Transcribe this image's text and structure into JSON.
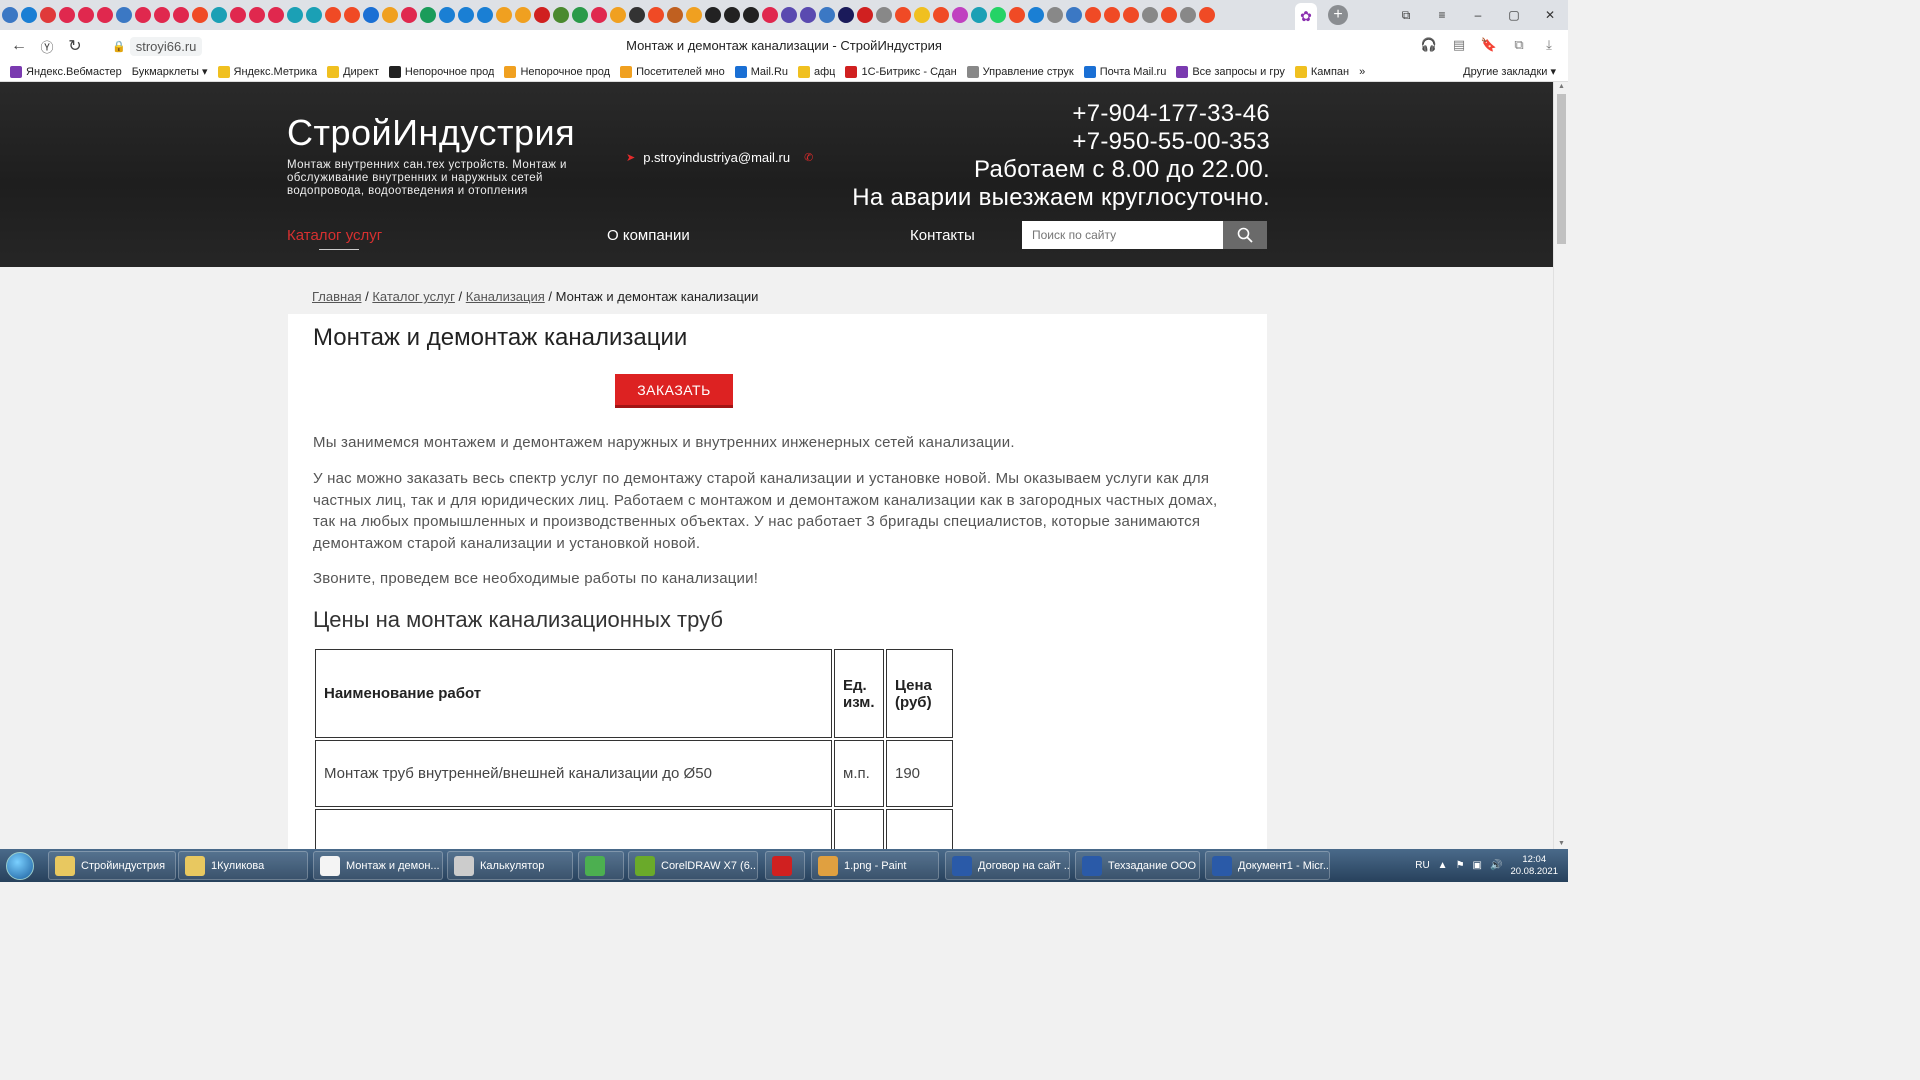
{
  "browser": {
    "title": "Монтаж и демонтаж канализации - СтройИндустрия",
    "url": "stroyi66.ru",
    "bookmarks": [
      "Яндекс.Вебмастер",
      "Букмарклеты ▾",
      "Яндекс.Метрика",
      "Директ",
      "Непорочное прод",
      "Непорочное прод",
      "Посетителей мно",
      "Mail.Ru",
      "афц",
      "1С-Битрикс - Сдан",
      "Управление струк",
      "Почта Mail.ru",
      "Все запросы и гру",
      "Кампан",
      "»",
      "Другие закладки ▾"
    ],
    "tab_icon_colors": [
      "#3b78c4",
      "#1a7fd4",
      "#e03a3a",
      "#e0284e",
      "#e0284e",
      "#e0284e",
      "#3b78c4",
      "#e0284e",
      "#e0284e",
      "#e0284e",
      "#f04a25",
      "#1ba0b5",
      "#e0284e",
      "#e0284e",
      "#e0284e",
      "#1ba0b5",
      "#1ba0b5",
      "#f04a25",
      "#f04a25",
      "#1a6fd4",
      "#f0a020",
      "#e0284e",
      "#1a9c5a",
      "#1a7fd4",
      "#1a7fd4",
      "#1a7fd4",
      "#f0a020",
      "#f0a020",
      "#d02020",
      "#4a8a30",
      "#2a9a4a",
      "#e0284e",
      "#f0a020",
      "#333333",
      "#f04a25",
      "#c06020",
      "#f0a020",
      "#222222",
      "#222222",
      "#222222",
      "#e0284e",
      "#5a4ab0",
      "#5a4ab0",
      "#3b78c4",
      "#1a1a5a",
      "#d02020",
      "#888888",
      "#f04a25",
      "#f0c020",
      "#f04a25",
      "#c040c0",
      "#1ba0b5",
      "#25d366",
      "#f04a25",
      "#1a7fd4",
      "#888888",
      "#3b78c4",
      "#f04a25",
      "#f04a25",
      "#f04a25",
      "#888888",
      "#f04a25",
      "#888888",
      "#f04a25"
    ],
    "window_controls": [
      "⧉",
      "≡",
      "–",
      "▢",
      "✕"
    ]
  },
  "site": {
    "logo": "СтройИндустрия",
    "tagline": "Монтаж внутренних сан.тех устройств. Монтаж и обслуживание внутренних и наружных сетей водопровода, водоотведения и отопления",
    "email": "p.stroyindustriya@mail.ru",
    "phones": [
      "+7-904-177-33-46",
      "+7-950-55-00-353"
    ],
    "hours": "Работаем с 8.00 до 22.00.",
    "emergency": "На аварии выезжаем круглосуточно.",
    "nav": {
      "catalog": "Каталог услуг",
      "about": "О компании",
      "contacts": "Контакты"
    },
    "search_placeholder": "Поиск по сайту",
    "accent_color": "#dd2222"
  },
  "breadcrumb": {
    "home": "Главная",
    "catalog": "Каталог услуг",
    "category": "Канализация",
    "current": "Монтаж и демонтаж канализации"
  },
  "page": {
    "title": "Монтаж и демонтаж канализации",
    "order_button": "ЗАКАЗАТЬ",
    "p1": "Мы занимемся монтажем и демонтажем наружных и внутренних инженерных сетей канализации.",
    "p2": "У нас можно заказать весь спектр услуг по демонтажу старой канализации и установке новой. Мы оказываем услуги как для частных лиц, так и для юридических лиц. Работаем с монтажом и демонтажом канализации как в загородных частных домах, так на любых промышленных и производственных объектах. У нас работает 3 бригады специалистов, которые занимаются демонтажом старой канализации и установкой новой.",
    "p3": "Звоните, проведем все необходимые работы по канализации!",
    "prices_heading": "Цены на монтаж канализационных труб",
    "table": {
      "headers": [
        "Наименование работ",
        "Ед. изм.",
        "Цена (руб)"
      ],
      "rows": [
        [
          "Монтаж труб внутренней/внешней канализации до Ø50",
          "м.п.",
          "190"
        ],
        [
          "",
          "",
          ""
        ]
      ]
    }
  },
  "taskbar": {
    "items": [
      "Стройиндустрия",
      "1Куликова",
      "Монтаж и демон...",
      "Калькулятор",
      "",
      "CorelDRAW X7 (6...",
      "",
      "1.png - Paint",
      "Договор на сайт ...",
      "Техзадание ООО ...",
      "Документ1 - Micr..."
    ],
    "lang": "RU",
    "time": "12:04",
    "date": "20.08.2021"
  }
}
